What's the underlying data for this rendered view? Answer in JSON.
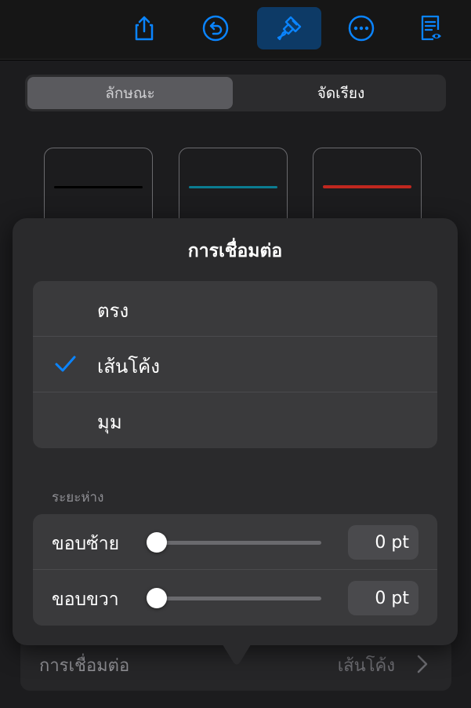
{
  "colors": {
    "accent": "#0a84ff",
    "toolbar_active": "#0d3a66",
    "panel": "#1c1c1e",
    "popover": "#2a2a2c"
  },
  "toolbar": {
    "buttons": [
      {
        "icon": "share-icon",
        "active": false
      },
      {
        "icon": "undo-icon",
        "active": false
      },
      {
        "icon": "paintbrush-icon",
        "active": true
      },
      {
        "icon": "more-icon",
        "active": false
      },
      {
        "icon": "reading-view-icon",
        "active": false
      }
    ]
  },
  "segment": {
    "items": [
      "ลักษณะ",
      "จัดเรียง"
    ],
    "selected": 0
  },
  "line_styles": [
    {
      "name": "black-line",
      "color": "#000000"
    },
    {
      "name": "teal-line",
      "color": "#0b7c91"
    },
    {
      "name": "red-rough-line",
      "color": "#c0271f"
    }
  ],
  "popover": {
    "title": "การเชื่อมต่อ",
    "options": [
      {
        "label": "ตรง",
        "checked": false
      },
      {
        "label": "เส้นโค้ง",
        "checked": true
      },
      {
        "label": "มุม",
        "checked": false
      }
    ],
    "spacing_header": "ระยะห่าง",
    "spacing": [
      {
        "label": "ขอบซ้าย",
        "value": "0 pt",
        "level": 0
      },
      {
        "label": "ขอบขวา",
        "value": "0 pt",
        "level": 0
      }
    ]
  },
  "bottom_row": {
    "label": "การเชื่อมต่อ",
    "value": "เส้นโค้ง"
  }
}
